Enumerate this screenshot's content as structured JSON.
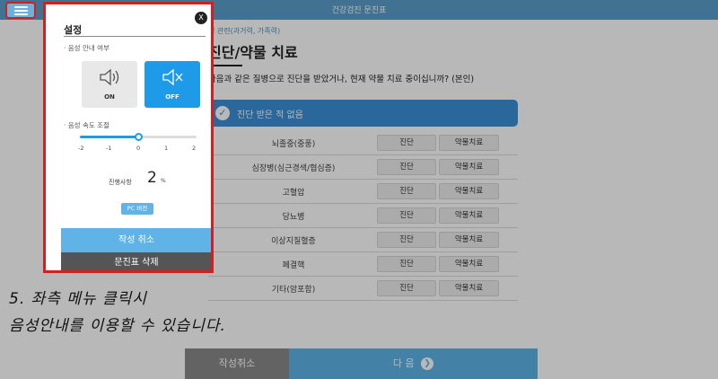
{
  "header": {
    "title": "건강검진 문진표"
  },
  "main": {
    "breadcrumb": "병 관련(과거력, 가족력)",
    "section_title": "진단/약물 치료",
    "question": "다음과 같은 질병으로 진단을 받았거나, 현재 약물 치료 중이십니까? (본인)",
    "none_option": "진단 받은 적 없음",
    "rows": [
      {
        "name": "뇌졸중(중풍)",
        "diag": "진단",
        "med": "약물치료"
      },
      {
        "name": "심장병(심근경색/협심증)",
        "diag": "진단",
        "med": "약물치료"
      },
      {
        "name": "고혈압",
        "diag": "진단",
        "med": "약물치료"
      },
      {
        "name": "당뇨병",
        "diag": "진단",
        "med": "약물치료"
      },
      {
        "name": "이상지질혈증",
        "diag": "진단",
        "med": "약물치료"
      },
      {
        "name": "폐결핵",
        "diag": "진단",
        "med": "약물치료"
      },
      {
        "name": "기타(암포함)",
        "diag": "진단",
        "med": "약물치료"
      }
    ],
    "cancel_label": "작성취소",
    "next_label": "다 음"
  },
  "settings": {
    "title": "설정",
    "close": "X",
    "voice_label": "· 음성 안내 여부",
    "on_label": "ON",
    "off_label": "OFF",
    "speed_label": "· 음성 속도 조절",
    "ticks": [
      "-2",
      "-1",
      "0",
      "1",
      "2"
    ],
    "speed_value": 0,
    "progress_label": "진행사항",
    "progress_value": "2",
    "progress_unit": "%",
    "pc_version": "PC 버전",
    "cancel_write": "작성 취소",
    "delete_form": "문진표 삭제"
  },
  "caption": {
    "line1": "5. 좌측 메뉴 클릭시",
    "line2": "음성안내를 이용할 수 있습니다."
  },
  "colors": {
    "accent": "#1e9be8",
    "header": "#5b9fc9",
    "highlight": "#d41f1f"
  }
}
